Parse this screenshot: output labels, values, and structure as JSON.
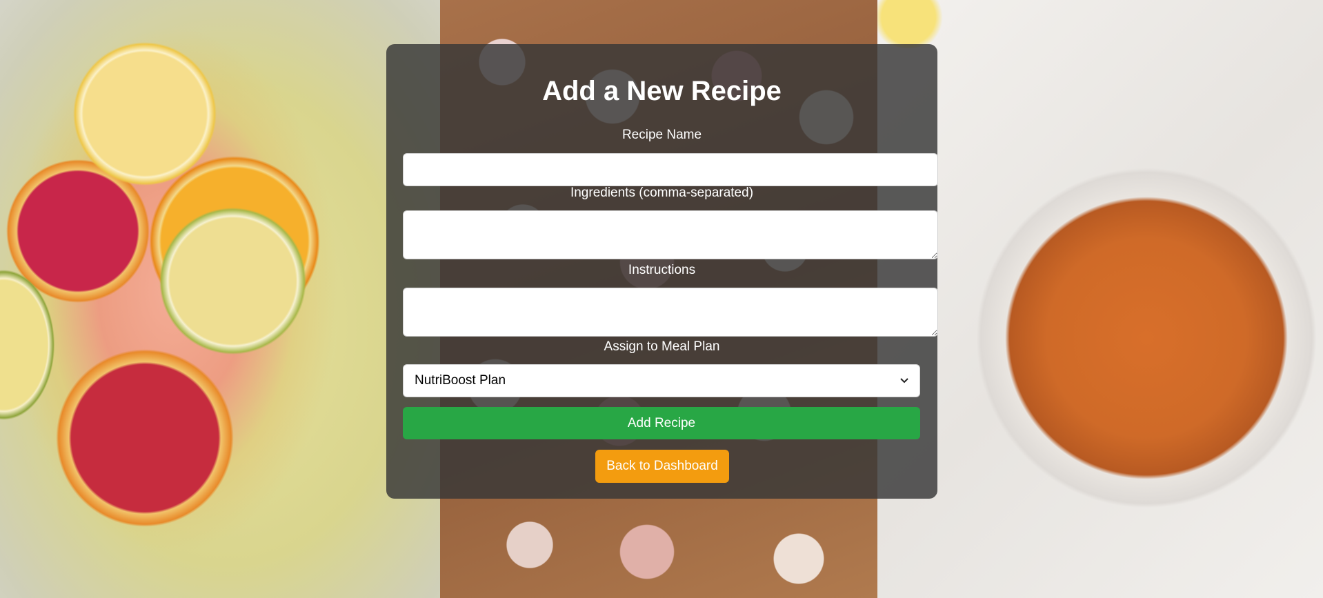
{
  "page": {
    "title": "Add a New Recipe"
  },
  "form": {
    "recipe_name": {
      "label": "Recipe Name",
      "value": ""
    },
    "ingredients": {
      "label": "Ingredients (comma-separated)",
      "value": ""
    },
    "instructions": {
      "label": "Instructions",
      "value": ""
    },
    "meal_plan": {
      "label": "Assign to Meal Plan",
      "selected": "NutriBoost Plan"
    }
  },
  "buttons": {
    "add_recipe": "Add Recipe",
    "back_to_dashboard": "Back to Dashboard"
  },
  "colors": {
    "card_overlay": "rgba(55,55,55,0.82)",
    "add_button": "#28a745",
    "back_button": "#f39c0f"
  },
  "background_images": [
    "salmon-citrus-photo",
    "potato-salad-photo",
    "shrimp-dish-photo"
  ]
}
